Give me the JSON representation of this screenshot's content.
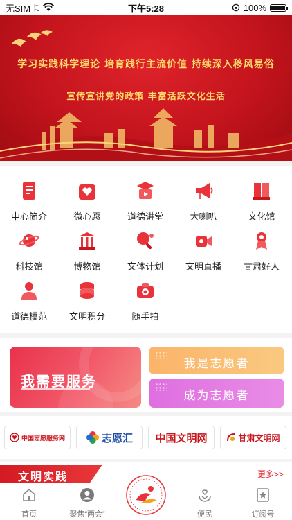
{
  "status": {
    "carrier": "无SIM卡",
    "time": "下午5:28",
    "battery": "100%",
    "battery_level": 1.0
  },
  "banner": {
    "line1": "学习实践科学理论  培育践行主流价值  持续深入移风易俗",
    "line2": "宣传宣讲党的政策     丰富活跃文化生活"
  },
  "grid": {
    "items": [
      {
        "label": "中心简介",
        "icon": "document-icon"
      },
      {
        "label": "微心愿",
        "icon": "heart-box-icon"
      },
      {
        "label": "道德讲堂",
        "icon": "lecture-icon"
      },
      {
        "label": "大喇叭",
        "icon": "megaphone-icon"
      },
      {
        "label": "文化馆",
        "icon": "book-building-icon"
      },
      {
        "label": "科技馆",
        "icon": "planet-icon"
      },
      {
        "label": "博物馆",
        "icon": "museum-icon"
      },
      {
        "label": "文体计划",
        "icon": "pingpong-icon"
      },
      {
        "label": "文明直播",
        "icon": "live-camera-icon"
      },
      {
        "label": "甘肃好人",
        "icon": "award-person-icon"
      },
      {
        "label": "道德模范",
        "icon": "person-icon"
      },
      {
        "label": "文明积分",
        "icon": "coins-icon"
      },
      {
        "label": "随手拍",
        "icon": "camera-icon"
      }
    ]
  },
  "services": {
    "need": "我需要服务",
    "volunteer": "我是志愿者",
    "become": "成为志愿者"
  },
  "logos": {
    "zgzy": "中国志愿服务网",
    "zyh": "志愿汇",
    "wmw": "中国文明网",
    "gswm": "甘肃文明网"
  },
  "section": {
    "title": "文明实践",
    "more": "更多>>"
  },
  "tabbar": {
    "items": [
      {
        "label": "首页",
        "icon": "home-icon"
      },
      {
        "label": "聚焦“两会”",
        "icon": "avatar-icon"
      },
      {
        "label": "便民",
        "icon": "hands-heart-icon"
      },
      {
        "label": "订阅号",
        "icon": "star-bookmark-icon"
      }
    ]
  },
  "colors": {
    "brand_red": "#e2232a",
    "volunteer_orange": "#fbb46a",
    "become_purple": "#df6fe0"
  }
}
